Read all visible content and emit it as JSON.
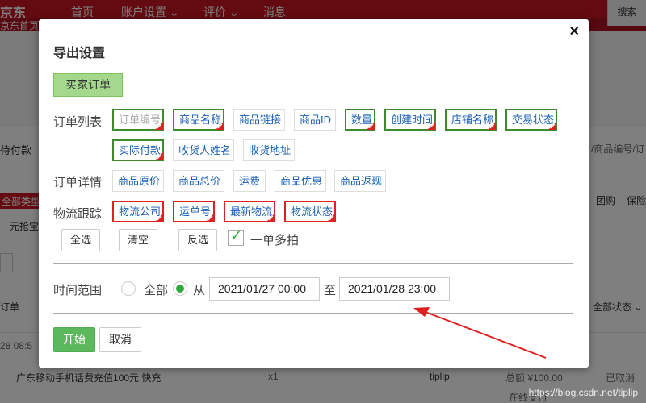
{
  "background": {
    "logo": "京东",
    "subnav_home": "京东首页",
    "nav": [
      "首页",
      "账户设置 ⌄",
      "评价 ⌄",
      "消息"
    ],
    "search_label": "搜索",
    "left_texts": [
      "待付款",
      "全部类型",
      "一元抢宝",
      "订单",
      "28 08:5"
    ],
    "right_texts": [
      "/商品编号/订",
      "团购",
      "保险",
      "全部状态 ⌄"
    ],
    "order_name": "广东移动手机话费充值100元 快充",
    "order_qty": "x1",
    "order_user": "tiplip",
    "order_total": "总额 ¥100.00",
    "order_status": "已取消",
    "order_more": "在线支付",
    "watermark": "https://blog.csdn.net/tiplip"
  },
  "modal": {
    "title": "导出设置",
    "close": "×",
    "buyer_tab": "买家订单",
    "order_list_label": "订单列表",
    "order_detail_label": "订单详情",
    "logistics_label": "物流跟踪",
    "order_list_tags": [
      "订单编号",
      "商品名称",
      "商品链接",
      "商品ID",
      "数量",
      "创建时间",
      "店铺名称",
      "交易状态",
      "实际付款",
      "收货人姓名",
      "收货地址"
    ],
    "order_detail_tags": [
      "商品原价",
      "商品总价",
      "运费",
      "商品优惠",
      "商品返现"
    ],
    "logistics_tags": [
      "物流公司",
      "运单号",
      "最新物流",
      "物流状态"
    ],
    "select_all": "全选",
    "clear": "清空",
    "invert": "反选",
    "multi_shot_label": "一单多拍",
    "multi_shot_checked": true,
    "time_range_label": "时间范围",
    "range_all": "全部",
    "range_from": "从",
    "range_to": "至",
    "start_date": "2021/01/27 00:00",
    "end_date": "2021/01/28 23:00",
    "start_button": "开始",
    "cancel_button": "取消"
  },
  "colors": {
    "selected_green": "#3d8a2f",
    "selected_red": "#d22222",
    "accent_green": "#5cb85c",
    "annotation_arrow": "#e02020"
  }
}
